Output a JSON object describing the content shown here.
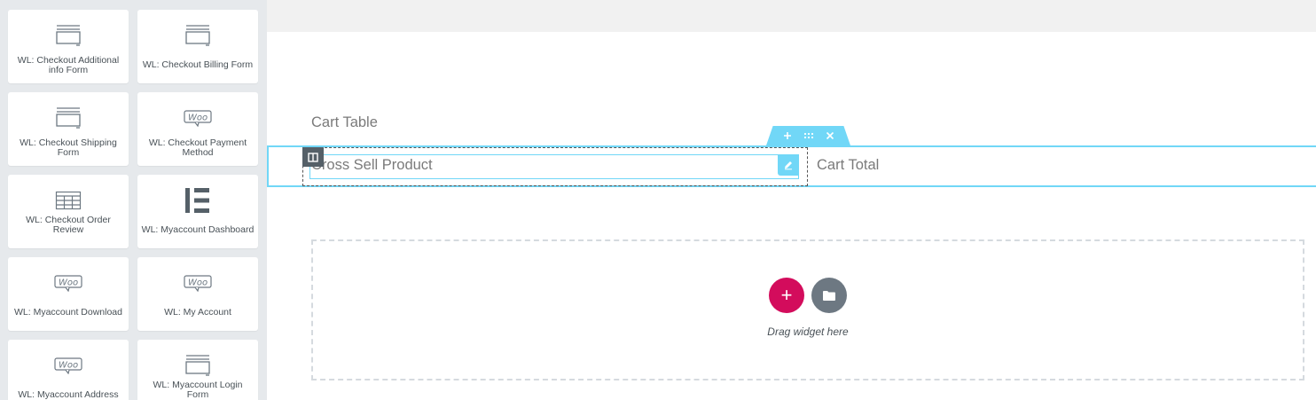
{
  "sidebar": {
    "widgets": [
      {
        "label": "WL: Checkout Additional info Form",
        "icon": "form-icon"
      },
      {
        "label": "WL: Checkout Billing Form",
        "icon": "form-icon"
      },
      {
        "label": "WL: Checkout Shipping Form",
        "icon": "form-icon"
      },
      {
        "label": "WL: Checkout Payment Method",
        "icon": "woo-icon"
      },
      {
        "label": "WL: Checkout Order Review",
        "icon": "table-icon"
      },
      {
        "label": "WL: Myaccount Dashboard",
        "icon": "elementor-icon"
      },
      {
        "label": "WL: Myaccount Download",
        "icon": "woo-icon"
      },
      {
        "label": "WL: My Account",
        "icon": "woo-icon"
      },
      {
        "label": "WL: Myaccount Address",
        "icon": "woo-icon"
      },
      {
        "label": "WL: Myaccount Login Form",
        "icon": "form-icon"
      }
    ],
    "collapse_icon": "chevron-left-icon",
    "woo_text": "Woo"
  },
  "canvas": {
    "heading_cart_table": "Cart Table",
    "heading_cross_sell": "Cross Sell Product",
    "heading_cart_total": "Cart Total",
    "drop_zone_text": "Drag widget here",
    "add_glyph": "+"
  },
  "colors": {
    "accent": "#71d7f7",
    "add_button": "#d30c5c",
    "folder_button": "#6d7882",
    "sidebar_bg": "#e6e9ec"
  }
}
